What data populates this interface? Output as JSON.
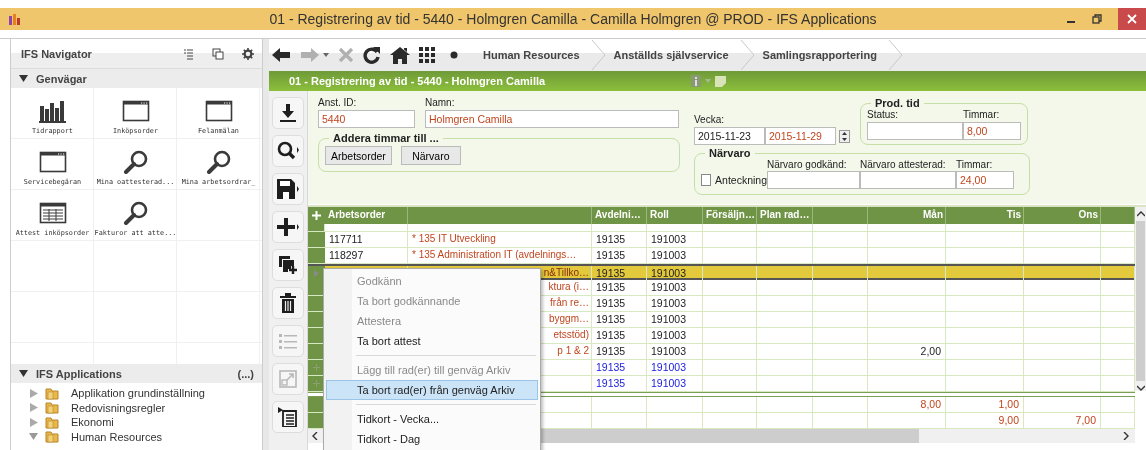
{
  "window": {
    "title": "01 - Registrering av tid - 5440 - Holmgren Camilla - Camilla Holmgren @ PROD - IFS Applications"
  },
  "navigator": {
    "title": "IFS Navigator",
    "shortcuts": {
      "title": "Genvägar",
      "expanded": true,
      "items": [
        {
          "label": "Tidrapport",
          "kind": "chart"
        },
        {
          "label": "Inköpsorder",
          "kind": "window"
        },
        {
          "label": "Felanmälan",
          "kind": "window"
        },
        {
          "label": "Servicebegäran",
          "kind": "window"
        },
        {
          "label": "Mina oattesterad...",
          "kind": "search"
        },
        {
          "label": "Mina arbetsordrar_",
          "kind": "search"
        },
        {
          "label": "Attest inköpsorder",
          "kind": "table"
        },
        {
          "label": "Fakturor att atte...",
          "kind": "search"
        }
      ]
    },
    "applications": {
      "title": "IFS Applications",
      "expanded": true,
      "more": "(...)",
      "items": [
        {
          "label": "Applikation grundinställning",
          "expanded": false
        },
        {
          "label": "Redovisningsregler",
          "expanded": false
        },
        {
          "label": "Ekonomi",
          "expanded": false
        },
        {
          "label": "Human Resources",
          "expanded": true
        }
      ]
    }
  },
  "nav_tools": [
    {
      "kind": "back",
      "disabled": false
    },
    {
      "kind": "forward",
      "disabled": true
    },
    {
      "kind": "close",
      "disabled": true
    },
    {
      "kind": "refresh",
      "disabled": false
    },
    {
      "kind": "home",
      "disabled": false
    },
    {
      "kind": "grid",
      "disabled": false
    },
    {
      "kind": "dot",
      "disabled": false
    }
  ],
  "breadcrumbs": [
    "Human Resources",
    "Anställds självservice",
    "Samlingsrapportering"
  ],
  "form_title": "01 - Registrering av tid - 5440 - Holmgren Camilla",
  "side_tools": [
    {
      "kind": "download",
      "disabled": false
    },
    {
      "kind": "search",
      "disabled": false
    },
    {
      "kind": "save",
      "disabled": false
    },
    {
      "kind": "add",
      "disabled": false
    },
    {
      "kind": "duplicate",
      "disabled": false
    },
    {
      "kind": "delete",
      "disabled": false
    },
    {
      "kind": "list",
      "disabled": true
    },
    {
      "kind": "expand",
      "disabled": true
    },
    {
      "kind": "details",
      "disabled": false
    }
  ],
  "form": {
    "employee_id": {
      "label": "Anst. ID:",
      "value": "5440",
      "readonly": true
    },
    "name": {
      "label": "Namn:",
      "value": "Holmgren Camilla",
      "readonly": true
    },
    "week": {
      "label": "Vecka:",
      "start": "2015-11-23",
      "end": "2015-11-29"
    },
    "prod_time": {
      "title": "Prod. tid",
      "status_label": "Status:",
      "hours_label": "Timmar:",
      "hours": "8,00"
    },
    "add_hours": {
      "title": "Addera timmar till ...",
      "buttons": [
        "Arbetsorder",
        "Närvaro"
      ]
    },
    "attendance": {
      "title": "Närvaro",
      "note_label": "Anteckning",
      "note_checked": false,
      "approved_label": "Närvaro godkänd:",
      "attested_label": "Närvaro attesterad:",
      "hours_label": "Timmar:",
      "hours": "24,00"
    }
  },
  "grid": {
    "columns": {
      "order": "Arbetsorder",
      "department": "Avdelni…",
      "role": "Roll",
      "sales": "Försäljn…",
      "plan_row": "Plan rad…",
      "mon": "Mån",
      "tue": "Tis",
      "wed": "Ons"
    },
    "rows": [
      {
        "order": "117711",
        "description": "* 135 IT Utveckling",
        "department": "19135",
        "role": "191003",
        "selected": false,
        "kind": "saved"
      },
      {
        "order": "118297",
        "description": "* 135 Administration IT (avdelnings…",
        "department": "19135",
        "role": "191003",
        "selected": false,
        "kind": "saved"
      },
      {
        "description": "n&Tillko…",
        "department": "19135",
        "role": "191003",
        "selected": true,
        "kind": "saved"
      },
      {
        "description": "ktura (i…",
        "department": "19135",
        "role": "191003",
        "selected": false,
        "kind": "saved"
      },
      {
        "description": "från re…",
        "department": "19135",
        "role": "191003",
        "selected": false,
        "kind": "saved"
      },
      {
        "description": "byggm…",
        "department": "19135",
        "role": "191003",
        "selected": false,
        "kind": "saved"
      },
      {
        "description": "etsstöd)",
        "department": "19135",
        "role": "191003",
        "selected": false,
        "kind": "saved"
      },
      {
        "description": "p 1 & 2",
        "department": "19135",
        "role": "191003",
        "mon": "2,00",
        "selected": false,
        "kind": "saved"
      },
      {
        "department": "19135",
        "role": "191003",
        "selected": false,
        "kind": "new"
      },
      {
        "department": "19135",
        "role": "191003",
        "selected": false,
        "kind": "new"
      }
    ],
    "totals": [
      {
        "mon": "8,00",
        "tue": "1,00"
      },
      {
        "tue": "9,00",
        "wed": "7,00"
      }
    ]
  },
  "context_menu": [
    {
      "kind": "item",
      "label": "Godkänn",
      "disabled": true,
      "selected": false
    },
    {
      "kind": "item",
      "label": "Ta bort godkännande",
      "disabled": true,
      "selected": false
    },
    {
      "kind": "item",
      "label": "Attestera",
      "disabled": true,
      "selected": false
    },
    {
      "kind": "item",
      "label": "Ta bort attest",
      "disabled": false,
      "selected": false
    },
    {
      "kind": "separator"
    },
    {
      "kind": "item",
      "label": "Lägg till rad(er) till genväg Arkiv",
      "disabled": true,
      "selected": false
    },
    {
      "kind": "item",
      "label": "Ta bort rad(er) från genväg Arkiv",
      "disabled": false,
      "selected": true
    },
    {
      "kind": "separator"
    },
    {
      "kind": "item",
      "label": "Tidkort - Vecka...",
      "disabled": false,
      "selected": false
    },
    {
      "kind": "item",
      "label": "Tidkort - Dag",
      "disabled": false,
      "selected": false
    }
  ]
}
